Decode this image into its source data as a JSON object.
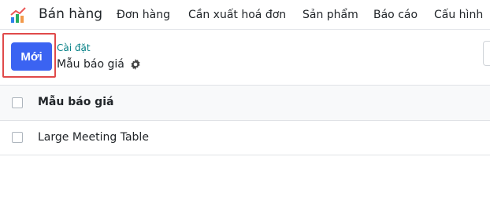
{
  "nav": {
    "app_name": "Bán hàng",
    "menu": [
      {
        "label": "Đơn hàng"
      },
      {
        "label": "Cần xuất hoá đơn"
      },
      {
        "label": "Sản phẩm"
      },
      {
        "label": "Báo cáo"
      },
      {
        "label": "Cấu hình"
      }
    ]
  },
  "control_panel": {
    "new_button": "Mới",
    "breadcrumb": "Cài đặt",
    "title": "Mẫu báo giá"
  },
  "table": {
    "column_header": "Mẫu báo giá",
    "rows": [
      {
        "name": "Large Meeting Table"
      }
    ]
  },
  "colors": {
    "primary": "#3b63f2",
    "breadcrumb": "#017e84",
    "highlight": "#e04a4a"
  }
}
